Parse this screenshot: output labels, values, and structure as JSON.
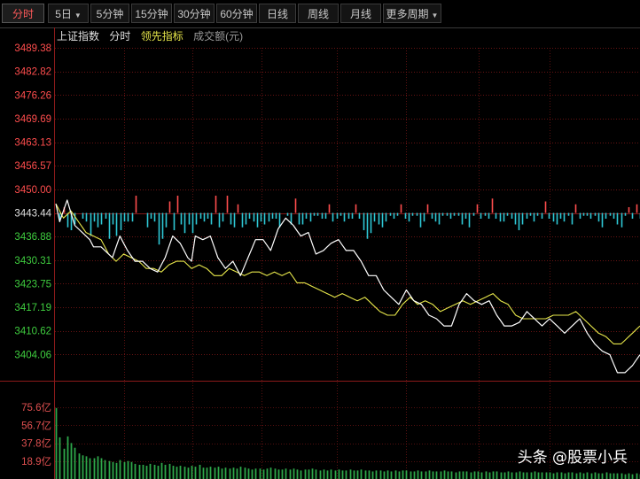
{
  "toolbar": {
    "tabs": [
      {
        "label": "分时",
        "active": true
      },
      {
        "label": "5日",
        "dropdown": true
      },
      {
        "label": "5分钟"
      },
      {
        "label": "15分钟"
      },
      {
        "label": "30分钟"
      },
      {
        "label": "60分钟"
      },
      {
        "label": "日线"
      },
      {
        "label": "周线"
      },
      {
        "label": "月线"
      },
      {
        "label": "更多周期",
        "dropdown": true
      }
    ]
  },
  "legend": {
    "index_name": "上证指数",
    "time_label": "分时",
    "leading_label": "领先指标",
    "volume_label": "成交额(元)"
  },
  "colors": {
    "up": "#ff4d4d",
    "down": "#2ec8d6",
    "price_line": "#ffffff",
    "avg_line": "#e6e64a",
    "volume_bar": "#2ea84a",
    "grid": "#8b1a1a",
    "price_label_up": "#ff4d4d",
    "price_label_ref": "#e0e0e0",
    "price_label_down": "#3fce3f",
    "volume_label": "#e05050"
  },
  "chart_data": {
    "type": "line",
    "price_axis": {
      "ticks": [
        "3489.38",
        "3482.82",
        "3476.26",
        "3469.69",
        "3463.13",
        "3456.57",
        "3450.00",
        "3443.44",
        "3436.88",
        "3430.31",
        "3423.75",
        "3417.19",
        "3410.62",
        "3404.06"
      ],
      "ylim": [
        3397.5,
        3489.38
      ],
      "reference": 3443.44
    },
    "volume_axis": {
      "ticks": [
        "75.6亿",
        "56.7亿",
        "37.8亿",
        "18.9亿"
      ],
      "ylim": [
        0,
        94.5
      ],
      "unit": "亿"
    },
    "series": [
      {
        "name": "分时",
        "values": [
          3446,
          3442,
          3446,
          3444,
          3438,
          3438,
          3441,
          3434,
          3432,
          3428,
          3433,
          3439,
          3437,
          3435,
          3433,
          3433,
          3427,
          3426,
          3424,
          3427,
          3427,
          3437,
          3438,
          3437,
          3434,
          3428,
          3424,
          3431,
          3435,
          3432,
          3440,
          3444,
          3440,
          3436,
          3438,
          3434,
          3436,
          3433,
          3432,
          3431,
          3430,
          3427,
          3425,
          3425,
          3422,
          3423,
          3419,
          3421,
          3422,
          3420,
          3421,
          3418,
          3416,
          3420,
          3424,
          3426,
          3424,
          3425,
          3422,
          3416,
          3413,
          3418,
          3422,
          3419,
          3418,
          3421,
          3420,
          3416,
          3414,
          3411,
          3409,
          3407,
          3408,
          3407,
          3404,
          3401
        ],
        "anchors": [
          [
            0,
            3446
          ],
          [
            1,
            3441
          ],
          [
            3,
            3447
          ],
          [
            5,
            3440
          ],
          [
            7,
            3438
          ],
          [
            9,
            3436
          ],
          [
            10,
            3434
          ],
          [
            12,
            3434
          ],
          [
            15,
            3431
          ],
          [
            17,
            3437
          ],
          [
            19,
            3433
          ],
          [
            21,
            3430
          ],
          [
            23,
            3430
          ],
          [
            25,
            3428
          ],
          [
            27,
            3427
          ],
          [
            29,
            3431
          ],
          [
            31,
            3437
          ],
          [
            33,
            3435
          ],
          [
            35,
            3431
          ],
          [
            36,
            3430
          ],
          [
            37,
            3437
          ],
          [
            39,
            3436
          ],
          [
            41,
            3437
          ],
          [
            43,
            3431
          ],
          [
            45,
            3428
          ],
          [
            47,
            3430
          ],
          [
            49,
            3426
          ],
          [
            51,
            3431
          ],
          [
            53,
            3436
          ],
          [
            55,
            3436
          ],
          [
            57,
            3433
          ],
          [
            59,
            3439
          ],
          [
            61,
            3442
          ],
          [
            63,
            3440
          ],
          [
            65,
            3437
          ],
          [
            67,
            3438
          ],
          [
            69,
            3432
          ],
          [
            71,
            3433
          ],
          [
            73,
            3435
          ],
          [
            75,
            3436
          ],
          [
            77,
            3433
          ],
          [
            79,
            3433
          ],
          [
            81,
            3430
          ],
          [
            83,
            3426
          ],
          [
            85,
            3426
          ],
          [
            87,
            3422
          ],
          [
            89,
            3420
          ],
          [
            91,
            3418
          ],
          [
            93,
            3422
          ],
          [
            95,
            3419
          ],
          [
            97,
            3418
          ],
          [
            99,
            3415
          ],
          [
            101,
            3414
          ],
          [
            103,
            3412
          ],
          [
            105,
            3412
          ],
          [
            107,
            3418
          ],
          [
            109,
            3421
          ],
          [
            111,
            3419
          ],
          [
            113,
            3418
          ],
          [
            115,
            3419
          ],
          [
            117,
            3415
          ],
          [
            119,
            3412
          ],
          [
            121,
            3412
          ],
          [
            123,
            3413
          ],
          [
            125,
            3416
          ],
          [
            127,
            3414
          ],
          [
            129,
            3412
          ],
          [
            131,
            3414
          ],
          [
            133,
            3412
          ],
          [
            135,
            3410
          ],
          [
            137,
            3412
          ],
          [
            139,
            3414
          ],
          [
            141,
            3410
          ],
          [
            143,
            3407
          ],
          [
            145,
            3405
          ],
          [
            147,
            3404
          ],
          [
            149,
            3399
          ],
          [
            151,
            3399
          ],
          [
            153,
            3401
          ],
          [
            155,
            3404
          ]
        ]
      },
      {
        "name": "领先指标",
        "anchors": [
          [
            0,
            3446
          ],
          [
            2,
            3442
          ],
          [
            4,
            3444
          ],
          [
            6,
            3441
          ],
          [
            8,
            3438
          ],
          [
            10,
            3437
          ],
          [
            12,
            3436
          ],
          [
            14,
            3432
          ],
          [
            16,
            3430
          ],
          [
            18,
            3432
          ],
          [
            20,
            3431
          ],
          [
            22,
            3430
          ],
          [
            24,
            3428
          ],
          [
            26,
            3428
          ],
          [
            28,
            3427
          ],
          [
            30,
            3429
          ],
          [
            32,
            3430
          ],
          [
            34,
            3430
          ],
          [
            36,
            3428
          ],
          [
            38,
            3429
          ],
          [
            40,
            3428
          ],
          [
            42,
            3426
          ],
          [
            44,
            3426
          ],
          [
            46,
            3428
          ],
          [
            48,
            3427
          ],
          [
            50,
            3426
          ],
          [
            52,
            3427
          ],
          [
            54,
            3427
          ],
          [
            56,
            3426
          ],
          [
            58,
            3427
          ],
          [
            60,
            3426
          ],
          [
            62,
            3427
          ],
          [
            64,
            3424
          ],
          [
            66,
            3424
          ],
          [
            68,
            3423
          ],
          [
            70,
            3422
          ],
          [
            72,
            3421
          ],
          [
            74,
            3420
          ],
          [
            76,
            3421
          ],
          [
            78,
            3420
          ],
          [
            80,
            3419
          ],
          [
            82,
            3420
          ],
          [
            84,
            3418
          ],
          [
            86,
            3416
          ],
          [
            88,
            3415
          ],
          [
            90,
            3415
          ],
          [
            92,
            3418
          ],
          [
            94,
            3420
          ],
          [
            96,
            3418
          ],
          [
            98,
            3419
          ],
          [
            100,
            3418
          ],
          [
            102,
            3416
          ],
          [
            104,
            3417
          ],
          [
            106,
            3418
          ],
          [
            108,
            3419
          ],
          [
            110,
            3418
          ],
          [
            112,
            3419
          ],
          [
            114,
            3420
          ],
          [
            116,
            3421
          ],
          [
            118,
            3419
          ],
          [
            120,
            3418
          ],
          [
            122,
            3415
          ],
          [
            124,
            3414
          ],
          [
            126,
            3414
          ],
          [
            128,
            3414
          ],
          [
            130,
            3414
          ],
          [
            132,
            3415
          ],
          [
            134,
            3415
          ],
          [
            136,
            3415
          ],
          [
            138,
            3416
          ],
          [
            140,
            3414
          ],
          [
            142,
            3412
          ],
          [
            144,
            3410
          ],
          [
            146,
            3409
          ],
          [
            148,
            3407
          ],
          [
            150,
            3407
          ],
          [
            152,
            3409
          ],
          [
            154,
            3411
          ],
          [
            155,
            3412
          ]
        ]
      }
    ],
    "leading_bars": [
      0,
      -3,
      2,
      -5,
      -6,
      -4,
      0,
      -2,
      -3,
      -8,
      -3,
      -5,
      -4,
      -2,
      -9,
      -4,
      -8,
      -6,
      -3,
      -3,
      -3,
      6,
      0,
      0,
      -5,
      -2,
      -3,
      -11,
      -9,
      -5,
      4,
      -6,
      6,
      -4,
      -7,
      -4,
      -7,
      -4,
      -2,
      -3,
      -2,
      -4,
      6,
      -5,
      -3,
      6,
      -4,
      -5,
      3,
      -5,
      -4,
      -2,
      -3,
      -5,
      -3,
      -4,
      -3,
      -2,
      -2,
      -5,
      0,
      -1,
      -4,
      5,
      -4,
      -4,
      -2,
      -3,
      -1,
      -1,
      -2,
      -2,
      3,
      -3,
      -2,
      -1,
      -3,
      -2,
      -2,
      3,
      -2,
      -6,
      -9,
      -7,
      -3,
      -4,
      -5,
      -3,
      -1,
      -2,
      -1,
      3,
      -2,
      -3,
      -1,
      -1,
      -5,
      -3,
      3,
      -2,
      -3,
      -4,
      -1,
      -1,
      -2,
      -1,
      -1,
      -4,
      -2,
      -5,
      -1,
      3,
      -2,
      -1,
      -2,
      5,
      -2,
      -3,
      -3,
      -1,
      -2,
      -4,
      -6,
      -4,
      -2,
      -1,
      -3,
      -1,
      -2,
      4,
      -2,
      -3,
      -4,
      -2,
      -3,
      -1,
      -4,
      3,
      -2,
      -1,
      -1,
      -2,
      -1,
      -3,
      -5,
      -2,
      -1,
      -2,
      -4,
      -5,
      -1,
      2,
      -2,
      3,
      -2
    ],
    "volume": [
      75,
      44,
      32,
      45,
      38,
      33,
      27,
      25,
      24,
      22,
      22,
      24,
      22,
      20,
      19,
      18,
      17,
      20,
      18,
      19,
      18,
      16,
      15,
      15,
      14,
      16,
      15,
      14,
      17,
      15,
      16,
      14,
      13,
      14,
      13,
      12,
      14,
      13,
      15,
      12,
      12,
      13,
      12,
      13,
      11,
      12,
      11,
      12,
      11,
      13,
      12,
      11,
      10,
      11,
      11,
      10,
      11,
      12,
      11,
      10,
      10,
      11,
      10,
      11,
      10,
      9,
      10,
      10,
      11,
      10,
      9,
      10,
      9,
      10,
      9,
      10,
      9,
      9,
      10,
      9,
      9,
      10,
      9,
      9,
      8,
      9,
      9,
      8,
      9,
      8,
      9,
      8,
      9,
      9,
      8,
      8,
      9,
      8,
      8,
      9,
      8,
      8,
      8,
      9,
      8,
      8,
      7,
      8,
      8,
      8,
      7,
      8,
      8,
      7,
      8,
      7,
      8,
      8,
      7,
      7,
      8,
      7,
      7,
      8,
      7,
      7,
      7,
      8,
      7,
      7,
      7,
      7,
      6,
      7,
      7,
      6,
      7,
      7,
      6,
      7,
      6,
      7,
      6,
      7,
      6,
      6,
      7,
      6,
      6,
      6,
      6,
      5,
      6,
      5,
      6,
      5
    ]
  },
  "watermark": "头条 @股票小兵"
}
